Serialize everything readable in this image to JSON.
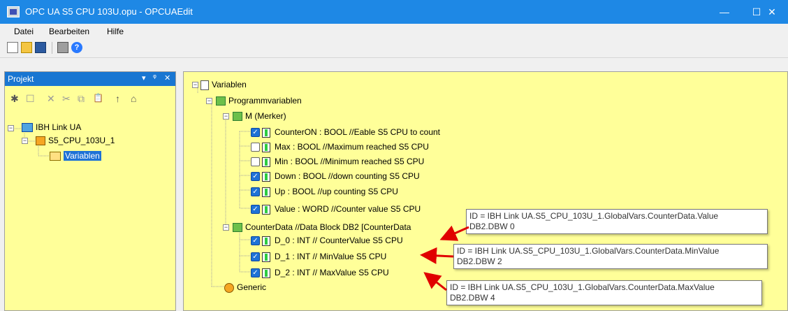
{
  "window": {
    "title": "OPC UA S5 CPU 103U.opu - OPCUAEdit",
    "minimize_glyph": "—",
    "maximize_glyph": "☐",
    "close_glyph": "✕"
  },
  "menu": [
    "Datei",
    "Bearbeiten",
    "Hilfe"
  ],
  "toolbar": {
    "icons": [
      "new-file-icon",
      "open-folder-icon",
      "save-icon",
      "print-icon",
      "help-icon"
    ],
    "help_glyph": "?"
  },
  "project_panel": {
    "title": "Projekt",
    "header_buttons": [
      "▾",
      "ᵠ",
      "✕"
    ],
    "tools": [
      "✱",
      "☐",
      "✕",
      "✂",
      "⧉",
      "📋",
      "↑",
      "⌂"
    ],
    "tree": {
      "root": "IBH Link UA",
      "cpu": "S5_CPU_103U_1",
      "vars": "Variablen"
    }
  },
  "variables_tree": {
    "root": "Variablen",
    "program_vars": "Programmvariablen",
    "merker": "M (Merker)",
    "merker_items": [
      {
        "label": "CounterON : BOOL   //Eable S5 CPU to count",
        "checked": true
      },
      {
        "label": "Max : BOOL   //Maximum reached S5 CPU",
        "checked": false
      },
      {
        "label": "Min : BOOL   //Minimum reached S5 CPU",
        "checked": false
      },
      {
        "label": "Down : BOOL   //down counting S5 CPU",
        "checked": true
      },
      {
        "label": "Up : BOOL   //up counting S5 CPU",
        "checked": true
      },
      {
        "label": "Value : WORD   //Counter value S5 CPU",
        "checked": true
      }
    ],
    "counter_data": "CounterData   //Data Block DB2 [CounterData",
    "counter_items": [
      {
        "label": "D_0 : INT   // CounterValue S5 CPU",
        "checked": true
      },
      {
        "label": "D_1 : INT   // MinValue S5 CPU",
        "checked": true
      },
      {
        "label": "D_2 : INT   // MaxValue S5 CPU",
        "checked": true
      }
    ],
    "generic": "Generic"
  },
  "tooltips": [
    {
      "line1": "ID = IBH Link UA.S5_CPU_103U_1.GlobalVars.CounterData.Value",
      "line2": "DB2.DBW 0"
    },
    {
      "line1": "ID = IBH Link UA.S5_CPU_103U_1.GlobalVars.CounterData.MinValue",
      "line2": "DB2.DBW 2"
    },
    {
      "line1": "ID = IBH Link UA.S5_CPU_103U_1.GlobalVars.CounterData.MaxValue",
      "line2": "DB2.DBW 4"
    }
  ],
  "colors": {
    "titlebar": "#1e88e5",
    "panel_background": "#ffff99",
    "selection": "#1e72d6",
    "arrow": "#e00000"
  }
}
